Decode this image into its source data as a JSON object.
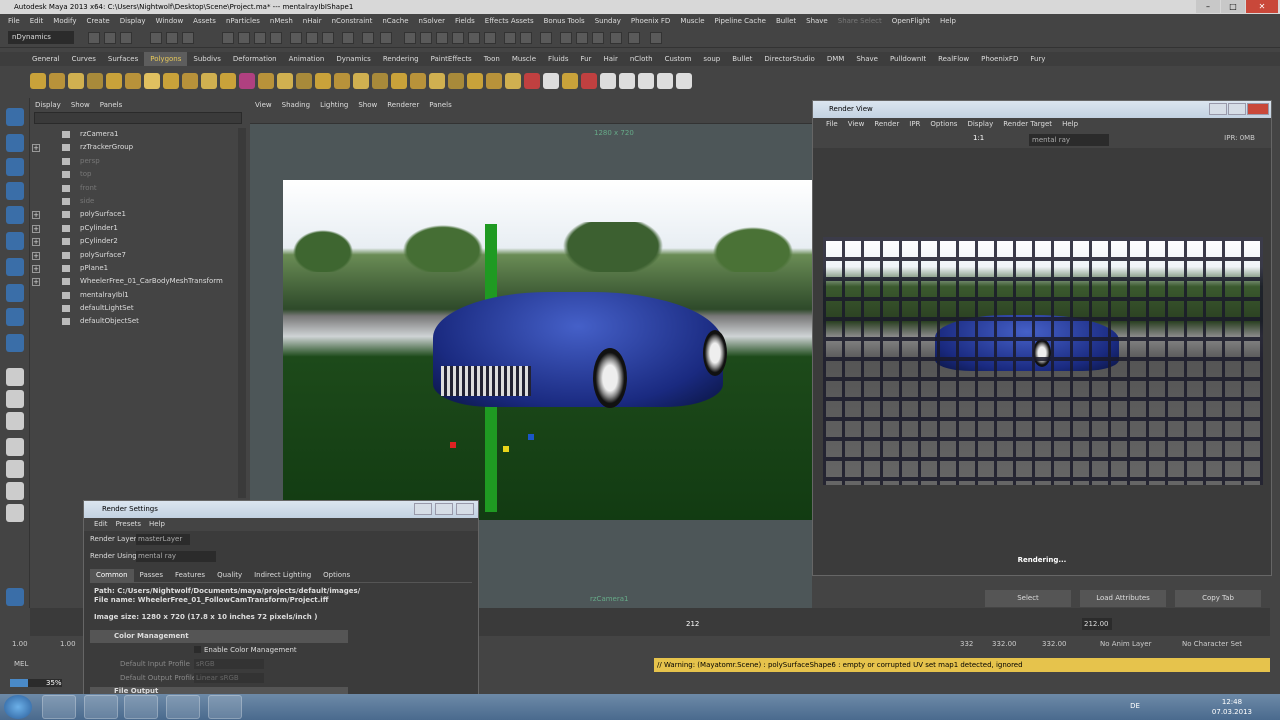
{
  "window": {
    "title": "Autodesk Maya 2013 x64: C:\\Users\\Nightwolf\\Desktop\\Scene\\Project.ma*   ---   mentalrayIbIShape1"
  },
  "menu": [
    "File",
    "Edit",
    "Modify",
    "Create",
    "Display",
    "Window",
    "Assets",
    "nParticles",
    "nMesh",
    "nHair",
    "nConstraint",
    "nCache",
    "nSolver",
    "Fields",
    "Effects Assets",
    "Bonus Tools",
    "Sunday",
    "Phoenix FD",
    "Muscle",
    "Pipeline Cache",
    "Bullet",
    "Shave",
    "Share Select",
    "OpenFlight",
    "Help"
  ],
  "mode_selector": "nDynamics",
  "shelf_tabs": [
    "General",
    "Curves",
    "Surfaces",
    "Polygons",
    "Subdivs",
    "Deformation",
    "Animation",
    "Dynamics",
    "Rendering",
    "PaintEffects",
    "Toon",
    "Muscle",
    "Fluids",
    "Fur",
    "Hair",
    "nCloth",
    "Custom",
    "soup",
    "Bullet",
    "DirectorStudio",
    "DMM",
    "Shave",
    "PulldownIt",
    "RealFlow",
    "PhoenixFD",
    "Fury"
  ],
  "shelf_active": "Polygons",
  "outliner": {
    "menu": [
      "Display",
      "Show",
      "Panels"
    ],
    "items": [
      {
        "label": "rzCamera1",
        "dim": false,
        "exp": false
      },
      {
        "label": "rzTrackerGroup",
        "dim": false,
        "exp": true
      },
      {
        "label": "persp",
        "dim": true,
        "exp": false
      },
      {
        "label": "top",
        "dim": true,
        "exp": false
      },
      {
        "label": "front",
        "dim": true,
        "exp": false
      },
      {
        "label": "side",
        "dim": true,
        "exp": false
      },
      {
        "label": "polySurface1",
        "dim": false,
        "exp": true
      },
      {
        "label": "pCylinder1",
        "dim": false,
        "exp": true
      },
      {
        "label": "pCylinder2",
        "dim": false,
        "exp": true
      },
      {
        "label": "polySurface7",
        "dim": false,
        "exp": true
      },
      {
        "label": "pPlane1",
        "dim": false,
        "exp": true
      },
      {
        "label": "WheelerFree_01_CarBodyMeshTransform",
        "dim": false,
        "exp": true
      },
      {
        "label": "mentalrayIbl1",
        "dim": false,
        "exp": false
      },
      {
        "label": "defaultLightSet",
        "dim": false,
        "exp": false
      },
      {
        "label": "defaultObjectSet",
        "dim": false,
        "exp": false
      }
    ]
  },
  "viewport": {
    "menu": [
      "View",
      "Shading",
      "Lighting",
      "Show",
      "Renderer",
      "Panels"
    ],
    "resolution_label": "1280 x 720",
    "camera_label": "rzCamera1"
  },
  "render_view": {
    "title": "Render View",
    "menu": [
      "File",
      "View",
      "Render",
      "IPR",
      "Options",
      "Display",
      "Render Target",
      "Help"
    ],
    "ratio": "1:1",
    "renderer": "mental ray",
    "ipr": "IPR: 0MB",
    "status": "Rendering..."
  },
  "render_settings": {
    "title": "Render Settings",
    "menu": [
      "Edit",
      "Presets",
      "Help"
    ],
    "render_layer_label": "Render Layer",
    "render_layer": "masterLayer",
    "render_using_label": "Render Using",
    "render_using": "mental ray",
    "tabs": [
      "Common",
      "Passes",
      "Features",
      "Quality",
      "Indirect Lighting",
      "Options"
    ],
    "active_tab": "Common",
    "path": "Path: C:/Users/Nightwolf/Documents/maya/projects/default/images/",
    "file_name": "File name:  WheelerFree_01_FollowCamTransform/Project.iff",
    "image_size": "Image size: 1280 x 720 (17.8 x 10 inches 72 pixels/inch )",
    "color_mgmt": "Color Management",
    "enable_cm": "Enable Color Management",
    "input_profile_label": "Default Input Profile",
    "input_profile": "sRGB",
    "output_profile_label": "Default Output Profile",
    "output_profile": "Linear sRGB",
    "file_output": "File Output"
  },
  "attr_buttons": [
    "Select",
    "Load Attributes",
    "Copy Tab"
  ],
  "timeline": {
    "current_frame": "212",
    "frame_field": "212.00",
    "start": "1.00",
    "start2": "1.00",
    "end_a": "332",
    "end_b": "332.00",
    "end_c": "332.00",
    "anim_layer": "No Anim Layer",
    "char_set": "No Character Set"
  },
  "cmd": {
    "label": "MEL",
    "warning": "// Warning: (Mayatomr.Scene) : polySurfaceShape6 : empty or corrupted UV set map1 detected, ignored"
  },
  "progress": {
    "label": "35%",
    "value": 35
  },
  "taskbar": {
    "lang": "DE",
    "time": "12:48",
    "date": "07.03.2013"
  }
}
